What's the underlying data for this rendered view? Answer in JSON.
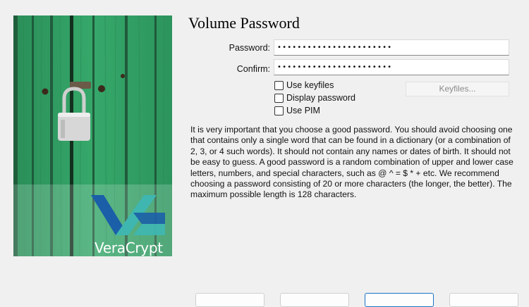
{
  "page": {
    "title": "Volume Password"
  },
  "image": {
    "logo_text": "VeraCrypt"
  },
  "form": {
    "password_label": "Password:",
    "password_value": "•••••••••••••••••••••••",
    "confirm_label": "Confirm:",
    "confirm_value": "•••••••••••••••••••••••",
    "keyfiles_button": "Keyfiles..."
  },
  "options": [
    {
      "label": "Use keyfiles",
      "checked": false
    },
    {
      "label": "Display password",
      "checked": false
    },
    {
      "label": "Use PIM",
      "checked": false
    }
  ],
  "info_text": "It is very important that you choose a good password. You should avoid choosing one that contains only a single word that can be found in a dictionary (or a combination of 2, 3, or 4 such words). It should not contain any names or dates of birth. It should not be easy to guess. A good password is a random combination of upper and lower case letters, numbers, and special characters, such as @ ^ = $ * + etc. We recommend choosing a password consisting of 20 or more characters (the longer, the better). The maximum possible length is 128 characters.",
  "colors": {
    "wood_green": "#2f9e62",
    "logo_blue": "#1b5fa8",
    "logo_teal": "#3fb6b0",
    "primary_button_border": "#1a74c9"
  }
}
